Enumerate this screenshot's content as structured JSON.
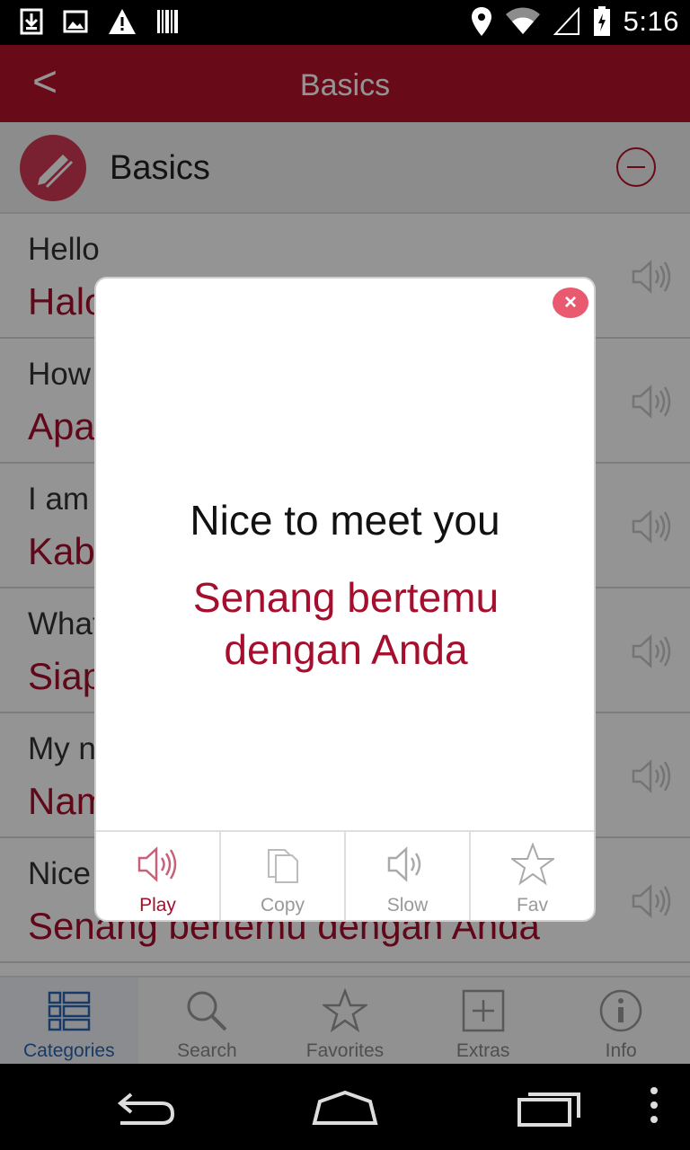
{
  "status_bar": {
    "time": "5:16",
    "left_icons": [
      "download-icon",
      "image-icon",
      "warning-icon",
      "barcode-icon"
    ],
    "right_icons": [
      "location-icon",
      "wifi-icon",
      "signal-icon",
      "battery-icon"
    ]
  },
  "toolbar": {
    "back_label": "<",
    "title": "Basics"
  },
  "section": {
    "title": "Basics",
    "icon": "pencil-icon",
    "collapse_icon": "minus-circle-icon"
  },
  "phrases": [
    {
      "en": "Hello",
      "id": "Halo"
    },
    {
      "en": "How are you?",
      "id": "Apa kabar?"
    },
    {
      "en": "I am fine",
      "id": "Kabar baik"
    },
    {
      "en": "What is your name?",
      "id": "Siapa nama Anda?"
    },
    {
      "en": "My name is",
      "id": "Nama saya"
    },
    {
      "en": "Nice to meet you",
      "id": "Senang bertemu dengan Anda"
    }
  ],
  "dialog": {
    "english": "Nice to meet you",
    "translation": "Senang bertemu dengan Anda",
    "close_label": "×",
    "actions": [
      {
        "label": "Play",
        "icon": "speaker-icon"
      },
      {
        "label": "Copy",
        "icon": "copy-icon"
      },
      {
        "label": "Slow",
        "icon": "speaker-slow-icon"
      },
      {
        "label": "Fav",
        "icon": "star-icon"
      }
    ]
  },
  "tabs": [
    {
      "label": "Categories",
      "icon": "categories-icon",
      "active": true
    },
    {
      "label": "Search",
      "icon": "search-icon",
      "active": false
    },
    {
      "label": "Favorites",
      "icon": "star-icon",
      "active": false
    },
    {
      "label": "Extras",
      "icon": "plus-box-icon",
      "active": false
    },
    {
      "label": "Info",
      "icon": "info-icon",
      "active": false
    }
  ],
  "colors": {
    "brand": "#b5122b",
    "translation": "#a50f2d",
    "active_tab": "#2a64b0",
    "close": "#e9596f"
  }
}
